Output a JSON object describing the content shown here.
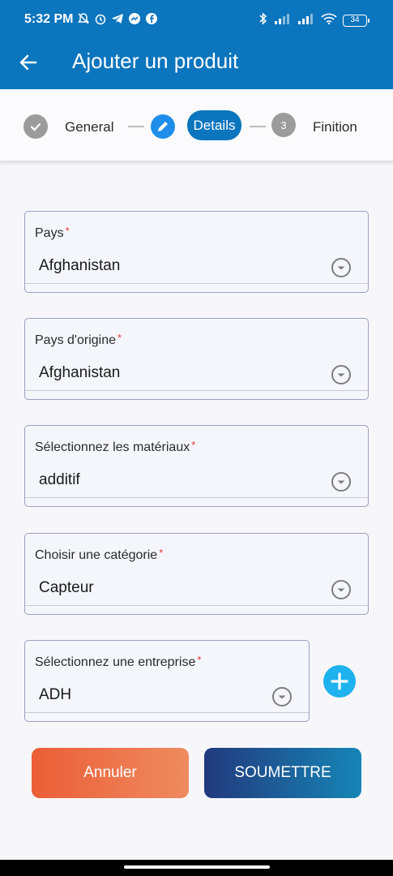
{
  "status": {
    "time": "5:32 PM",
    "battery": "34"
  },
  "app_bar": {
    "title": "Ajouter un produit"
  },
  "stepper": {
    "steps": [
      {
        "label": "General",
        "state": "done"
      },
      {
        "label": "Details",
        "state": "active"
      },
      {
        "label": "Finition",
        "state": "pending",
        "number": "3"
      }
    ]
  },
  "form": {
    "required_marker": "*",
    "fields": [
      {
        "label": "Pays",
        "value": "Afghanistan"
      },
      {
        "label": "Pays d'origine",
        "value": "Afghanistan"
      },
      {
        "label": "Sélectionnez les matériaux",
        "value": "additif"
      },
      {
        "label": "Choisir une catégorie",
        "value": "Capteur"
      },
      {
        "label": "Sélectionnez une entreprise",
        "value": "ADH"
      }
    ]
  },
  "buttons": {
    "cancel": "Annuler",
    "submit": "SOUMETTRE"
  },
  "colors": {
    "primary": "#0b75bd",
    "required": "#e53935",
    "add_button": "#1eb2ee",
    "cancel_gradient_start": "#eb5e37",
    "submit_gradient_start": "#223a7d"
  },
  "icons": [
    "back-arrow-icon",
    "check-icon",
    "pencil-icon",
    "dropdown-icon",
    "plus-icon"
  ]
}
